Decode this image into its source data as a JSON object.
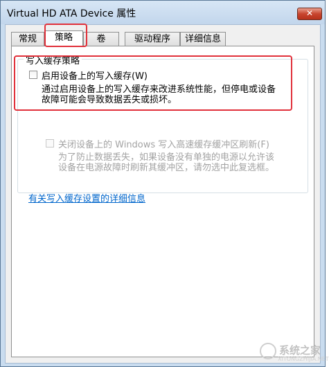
{
  "window": {
    "title": "Virtual HD ATA Device 属性",
    "close_glyph": "✕"
  },
  "tabs": [
    {
      "label": "常规",
      "selected": false
    },
    {
      "label": "策略",
      "selected": true
    },
    {
      "label": "卷",
      "selected": false
    },
    {
      "label": "驱动程序",
      "selected": false
    },
    {
      "label": "详细信息",
      "selected": false
    }
  ],
  "write_cache": {
    "group_title": "写入缓存策略",
    "enable_label": "启用设备上的写入缓存(W)",
    "enable_checked": false,
    "enable_desc_line1": "通过启用设备上的写入缓存来改进系统性能，但停电或设备",
    "enable_desc_line2": "故障可能会导致数据丢失或损坏。",
    "flush_label": "关闭设备上的 Windows 写入高速缓存缓冲区刷新(F)",
    "flush_checked": false,
    "flush_desc_line1": "为了防止数据丢失，如果设备没有单独的电源以允许该",
    "flush_desc_line2": "设备在电源故障时刷新其缓冲区，请勿选中此复选框。",
    "link_text": "有关写入缓存设置的详细信息"
  },
  "watermark": {
    "text": "系统之家",
    "sub": "XITONGZHIJIA.NET"
  },
  "colors": {
    "highlight_red": "#e1303a",
    "link_blue": "#0066cc"
  }
}
